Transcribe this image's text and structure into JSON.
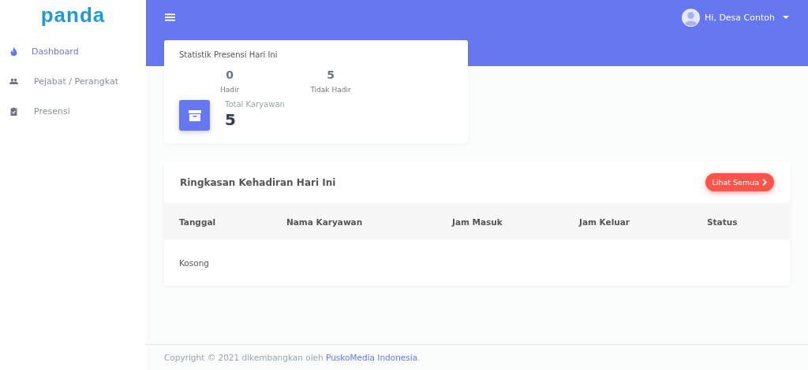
{
  "logo": "panda",
  "sidebar": {
    "items": [
      {
        "label": "Dashboard",
        "selected": true
      },
      {
        "label": "Pejabat / Perangkat",
        "selected": false
      },
      {
        "label": "Presensi",
        "selected": false
      }
    ]
  },
  "topbar": {
    "user": "Hi, Desa Contoh"
  },
  "stats_card": {
    "title": "Statistik Presensi Hari Ini",
    "stats": [
      {
        "value": "0",
        "label": "Hadir"
      },
      {
        "value": "5",
        "label": "Tidak Hadir"
      }
    ],
    "total_label": "Total Karyawan",
    "total_value": "5"
  },
  "summary": {
    "title": "Ringkasan Kehadiran Hari Ini",
    "button": "Lihat Semua",
    "columns": [
      "Tanggal",
      "Nama Karyawan",
      "Jam Masuk",
      "Jam Keluar",
      "Status"
    ],
    "empty": "Kosong"
  },
  "footer": {
    "text": "Copyright © 2021 dikembangkan oleh ",
    "link": "PuskoMedia Indonesia",
    "suffix": "."
  }
}
